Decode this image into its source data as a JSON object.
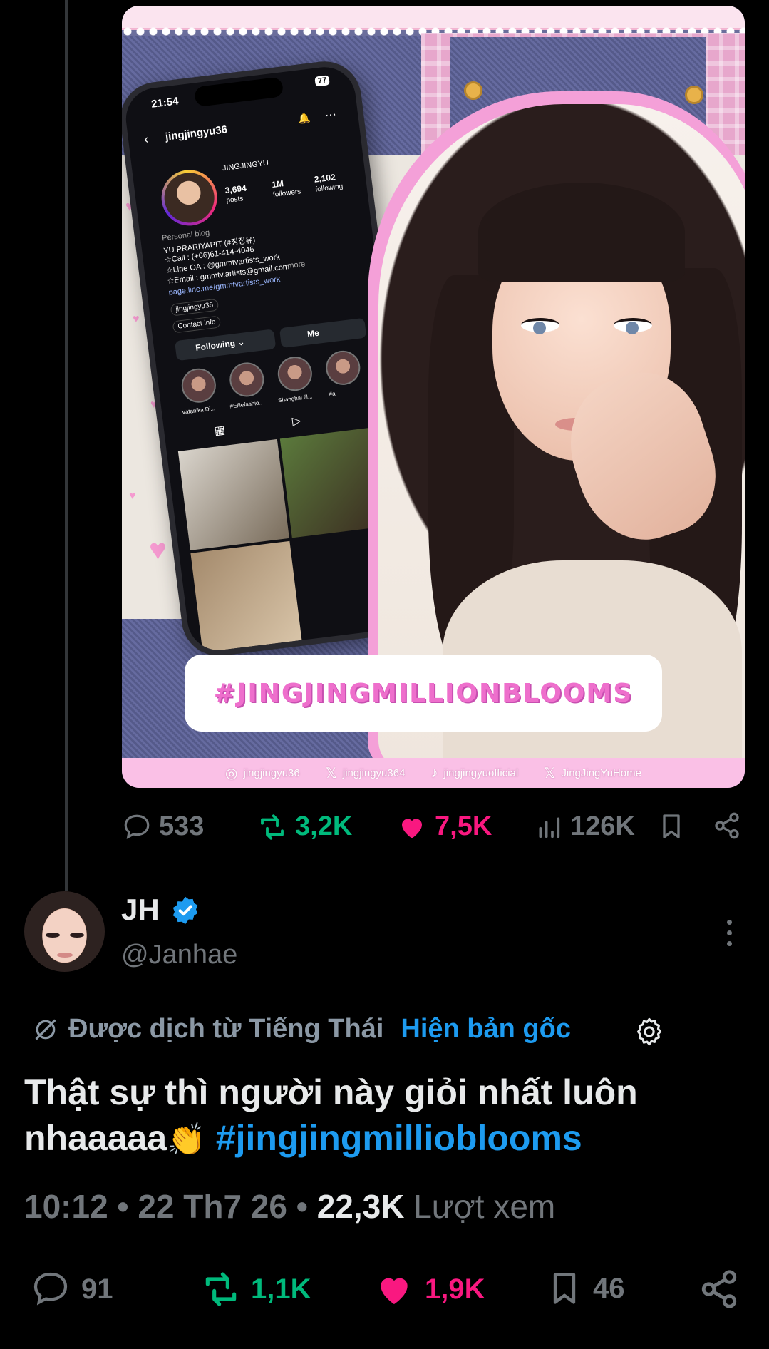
{
  "media": {
    "phone": {
      "time": "21:54",
      "battery": "77",
      "username": "jingjingyu36",
      "display_name": "JINGJINGYU",
      "posts_count": "3,694",
      "posts_label": "posts",
      "followers_count": "1M",
      "followers_label": "followers",
      "following_count": "2,102",
      "following_label": "following",
      "category": "Personal blog",
      "bio_name": "YU PRARIYAPIT (#징징유)",
      "bio_call": "☆Call : (+66)61-414-4046",
      "bio_line": "☆Line OA : @gmmtvartists_work",
      "bio_email": "☆Email : gmmtv.artists@gmail.com",
      "bio_more": "more",
      "bio_link": "page.line.me/gmmtvartists_work",
      "threads_handle": "jingjingyu36",
      "contact": "Contact info",
      "following_button": "Following ⌄",
      "message_button": "Me",
      "highlights": [
        "Vatanika Di...",
        "#Elliefashio...",
        "Shanghai fil...",
        "#a"
      ]
    },
    "hashtag": "#JINGJINGMILLIONBLOOMS",
    "socials": [
      {
        "icon": "instagram-icon",
        "glyph": "◎",
        "label": "jingjingyu36"
      },
      {
        "icon": "x-icon",
        "glyph": "𝕏",
        "label": "jingjingyu364"
      },
      {
        "icon": "tiktok-icon",
        "glyph": "♪",
        "label": "jingjingyuofficial"
      },
      {
        "icon": "x-icon",
        "glyph": "𝕏",
        "label": "JingJingYuHome"
      }
    ]
  },
  "parent_actions": {
    "replies": "533",
    "reposts": "3,2K",
    "likes": "7,5K",
    "views": "126K"
  },
  "reply": {
    "name": "JH",
    "handle": "@Janhae",
    "translated_label": "Được dịch từ Tiếng Thái",
    "show_original": "Hiện bản gốc",
    "text_line1": "Thật sự thì người này giỏi nhất luôn",
    "text_line2": "nhaaaaa",
    "clap": "👏",
    "hashtag": "#jingjingmilliobloom‌s",
    "time": "10:12",
    "sep1": " • ",
    "date": "22 Th7 26",
    "sep2": " • ",
    "views": "22,3K",
    "views_label": " Lượt xem"
  },
  "reply_actions": {
    "replies": "91",
    "reposts": "1,1K",
    "likes": "1,9K",
    "bookmarks": "46"
  },
  "colors": {
    "background": "#000000",
    "text": "#e7e9ea",
    "muted": "#71767b",
    "link": "#1d9bf0",
    "repost": "#00ba7c",
    "like": "#f91880"
  }
}
